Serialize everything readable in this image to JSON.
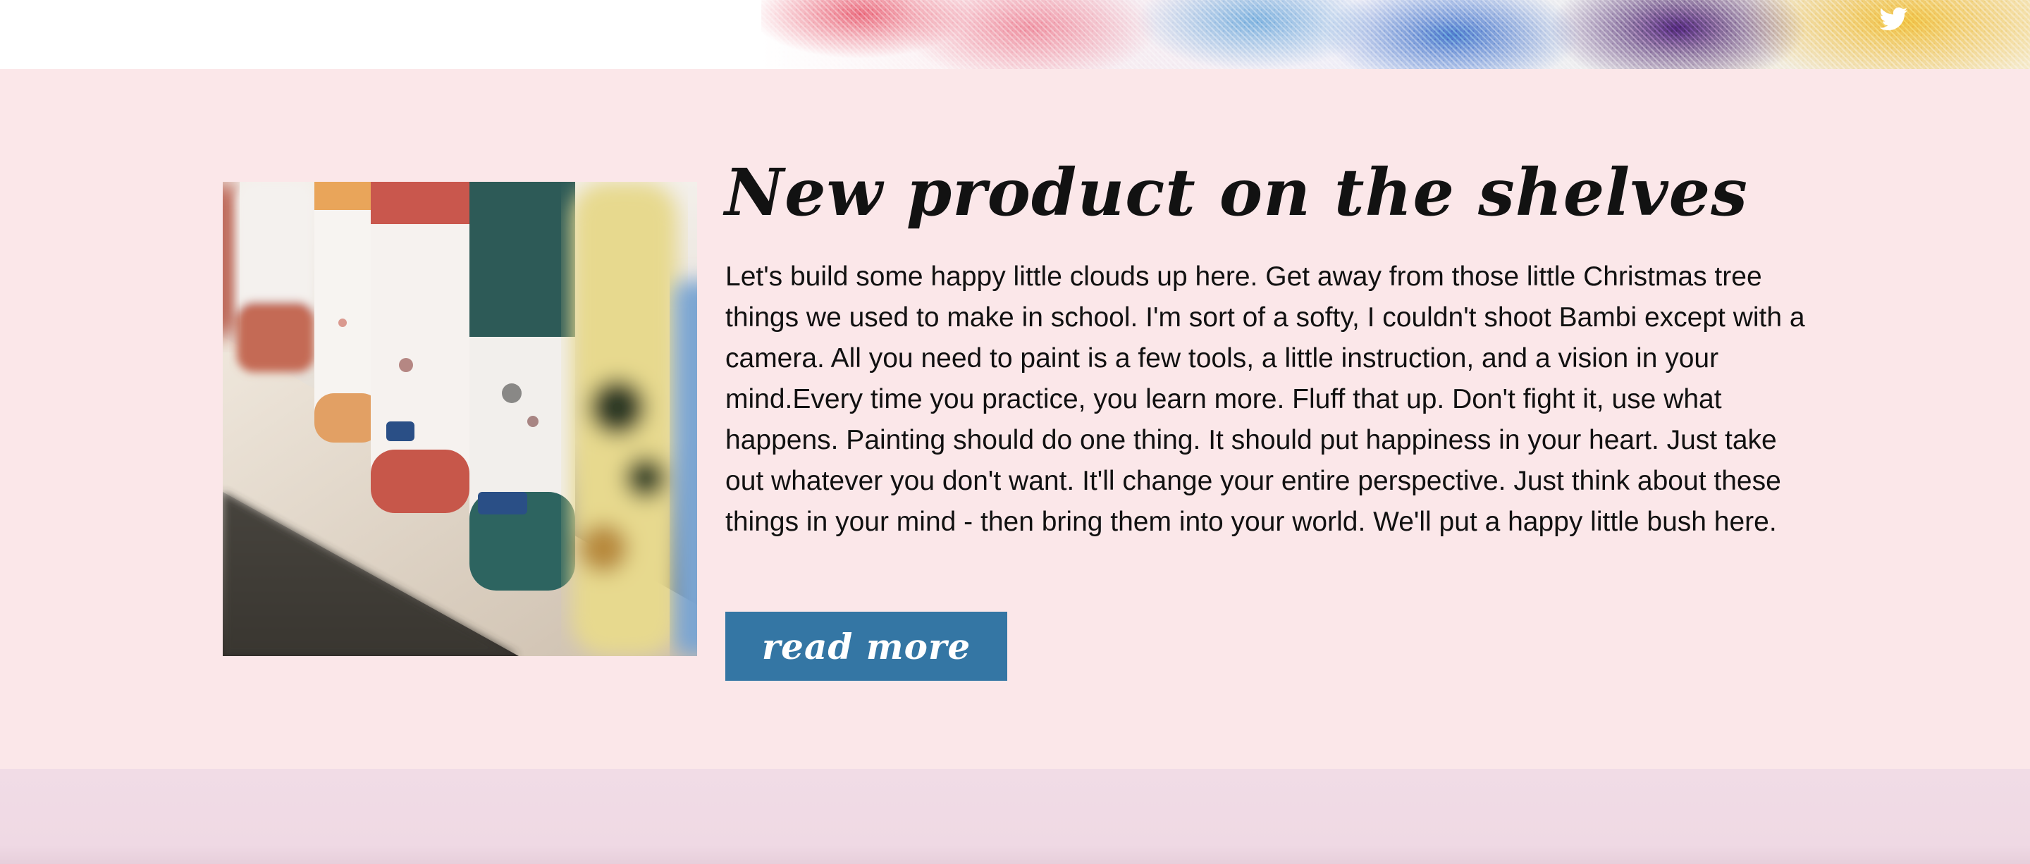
{
  "header": {
    "social": {
      "icon": "twitter-icon",
      "color": "#ffffff"
    },
    "banner": {
      "style": "paint-splash",
      "colors": [
        "#e85a6e",
        "#6eaadc",
        "#3c6ec8",
        "#461e6e",
        "#f0be3c"
      ]
    }
  },
  "feature": {
    "background": "#fbe7e9",
    "image": {
      "subject": "paint bottles on a wooden shelf"
    },
    "title": "New product on the shelves",
    "body": "Let's build some happy little clouds up here. Get away from those little Christmas tree things we used to make in school. I'm sort of a softy, I couldn't shoot Bambi except with a camera. All you need to paint is a few tools, a little instruction, and a vision in your mind.Every time you practice, you learn more. Fluff that up. Don't fight it, use what happens. Painting should do one thing. It should put happiness in your heart. Just take out whatever you don't want. It'll change your entire perspective. Just think about these things in your mind - then bring them into your world. We'll put a happy little bush here.",
    "button_label": "read more",
    "button_color": "#3476a4"
  },
  "footer_band": {
    "background": "#f1dce6"
  }
}
